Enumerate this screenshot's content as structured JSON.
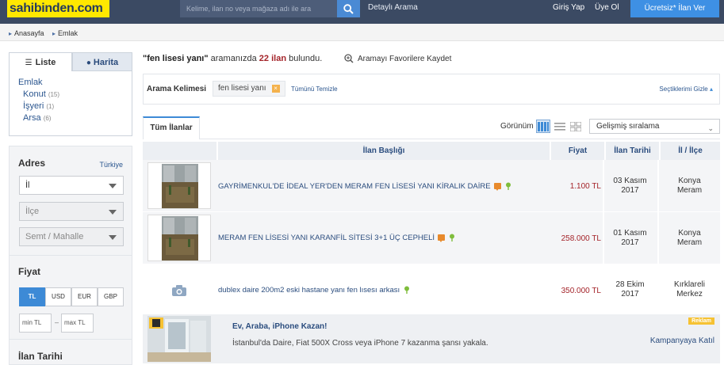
{
  "header": {
    "logo": "sahibinden.com",
    "search_placeholder": "Kelime, ilan no veya mağaza adı ile ara",
    "detailed_search": "Detaylı Arama",
    "login": "Giriş Yap",
    "signup": "Üye Ol",
    "post_ad": "Ücretsiz* İlan Ver"
  },
  "breadcrumb": [
    "Anasayfa",
    "Emlak"
  ],
  "sidebar": {
    "tab_list": "Liste",
    "tab_map": "Harita",
    "category_root": "Emlak",
    "categories": [
      {
        "label": "Konut",
        "count": "(15)"
      },
      {
        "label": "İşyeri",
        "count": "(1)"
      },
      {
        "label": "Arsa",
        "count": "(6)"
      }
    ],
    "address_label": "Adres",
    "country": "Türkiye",
    "city_select": "İl",
    "district_select": "İlçe",
    "neighborhood_select": "Semt / Mahalle",
    "price_label": "Fiyat",
    "currencies": [
      "TL",
      "USD",
      "EUR",
      "GBP"
    ],
    "active_currency": "TL",
    "min_placeholder": "min TL",
    "max_placeholder": "max TL",
    "range_dash": "–",
    "date_label": "İlan Tarihi"
  },
  "results": {
    "query": "\"fen lisesi yanı\"",
    "text_mid": "aramanızda",
    "count": "22 ilan",
    "text_end": "bulundu.",
    "save_favorite": "Aramayı Favorilere Kaydet"
  },
  "criteria": {
    "label": "Arama Kelimesi",
    "chip": "fen lisesi yanı",
    "clear_all": "Tümünü Temizle",
    "hide_selected": "Seçtiklerimi Gizle"
  },
  "listing_tabs": {
    "all": "Tüm İlanlar",
    "view_label": "Görünüm",
    "sort": "Gelişmiş sıralama"
  },
  "table": {
    "headers": [
      "İlan Başlığı",
      "Fiyat",
      "İlan Tarihi",
      "İl / İlçe"
    ],
    "rows": [
      {
        "title": "GAYRİMENKUL'DE İDEAL YER'DEN MERAM FEN LİSESİ YANI KİRALIK DAİRE",
        "price": "1.100 TL",
        "date_1": "03 Kasım",
        "date_2": "2017",
        "city": "Konya",
        "district": "Meram"
      },
      {
        "title": "MERAM FEN LİSESİ YANI KARANFİL SİTESİ 3+1 ÜÇ CEPHELİ",
        "price": "258.000 TL",
        "date_1": "01 Kasım",
        "date_2": "2017",
        "city": "Konya",
        "district": "Meram"
      },
      {
        "title": "dublex daire 200m2 eski hastane yanı fen lısesı arkası",
        "price": "350.000 TL",
        "date_1": "28 Ekim",
        "date_2": "2017",
        "city": "Kırklareli",
        "district": "Merkez"
      }
    ]
  },
  "ad": {
    "title": "Ev, Araba, iPhone Kazan!",
    "description": "İstanbul'da Daire, Fiat 500X Cross veya iPhone 7 kazanma şansı yakala.",
    "badge": "Reklam",
    "cta": "Kampanyaya Katıl"
  },
  "colors": {
    "topbar": "#3b4a63",
    "logo_bg": "#ffe800",
    "accent_blue": "#3d8ad6",
    "price_red": "#a4242a",
    "link_blue": "#2b4d7e"
  }
}
